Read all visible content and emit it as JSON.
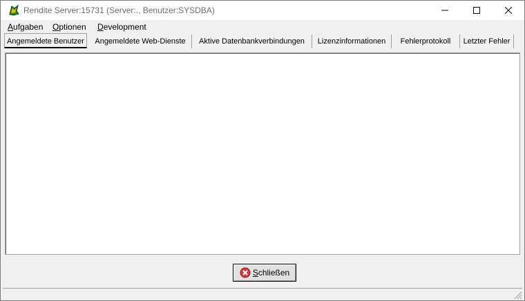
{
  "window": {
    "title": "Rendite Server:15731 (Server:., Benutzer:SYSDBA)",
    "icons": {
      "app": "rendite-app-icon",
      "minimize": "minimize-icon",
      "maximize": "maximize-icon",
      "close": "close-icon"
    }
  },
  "menu": {
    "items": [
      {
        "accel": "A",
        "rest": "ufgaben"
      },
      {
        "accel": "O",
        "rest": "ptionen"
      },
      {
        "accel": "D",
        "rest": "evelopment"
      }
    ]
  },
  "tabs": [
    {
      "label": "Angemeldete Benutzer",
      "active": true
    },
    {
      "label": "Angemeldete Web-Dienste",
      "active": false
    },
    {
      "label": "Aktive Datenbankverbindungen",
      "active": false
    },
    {
      "label": "Lizenzinformationen",
      "active": false
    },
    {
      "label": "Fehlerprotokoll",
      "active": false
    },
    {
      "label": "Letzter Fehler",
      "active": false
    }
  ],
  "footer": {
    "close_button": {
      "accel": "S",
      "rest": "chließen",
      "icon": "red-x-circle-icon"
    }
  },
  "colors": {
    "title_text": "#6d6d6d",
    "close_icon_red": "#d83b3b"
  }
}
